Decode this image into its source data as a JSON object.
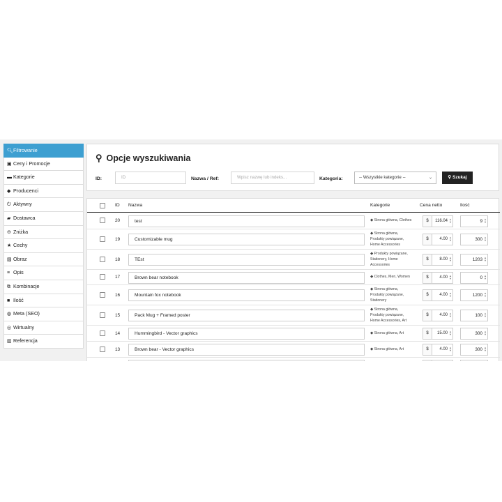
{
  "sidebar": {
    "items": [
      {
        "label": "Filtrowanie",
        "icon": "search-icon",
        "glyph": "🔍︎",
        "active": true
      },
      {
        "label": "Ceny i Promocje",
        "icon": "money-icon",
        "glyph": "▣"
      },
      {
        "label": "Kategorie",
        "icon": "folder-icon",
        "glyph": "▬"
      },
      {
        "label": "Producenci",
        "icon": "tag-icon",
        "glyph": "◆"
      },
      {
        "label": "Aktywny",
        "icon": "power-icon",
        "glyph": "⏻"
      },
      {
        "label": "Dostawca",
        "icon": "truck-icon",
        "glyph": "▰"
      },
      {
        "label": "Zniżka",
        "icon": "minus-circle-icon",
        "glyph": "⊖"
      },
      {
        "label": "Cechy",
        "icon": "star-icon",
        "glyph": "★"
      },
      {
        "label": "Obraz",
        "icon": "image-icon",
        "glyph": "▨"
      },
      {
        "label": "Opis",
        "icon": "align-icon",
        "glyph": "≡"
      },
      {
        "label": "Kombinacje",
        "icon": "copy-icon",
        "glyph": "⧉"
      },
      {
        "label": "Ilość",
        "icon": "box-icon",
        "glyph": "■"
      },
      {
        "label": "Meta (SEO)",
        "icon": "globe-icon",
        "glyph": "◍"
      },
      {
        "label": "Wirtualny",
        "icon": "disc-icon",
        "glyph": "◎"
      },
      {
        "label": "Referencja",
        "icon": "barcode-icon",
        "glyph": "▥"
      }
    ]
  },
  "search": {
    "title": "Opcje wyszukiwania",
    "id_label": "ID:",
    "id_placeholder": "ID",
    "name_label": "Nazwa / Ref:",
    "name_placeholder": "Wpisz nazwę lub indeks...",
    "category_label": "Kategoria:",
    "category_value": "-- Wszystkie kategorie --",
    "search_button": "Szukaj"
  },
  "table": {
    "columns": {
      "id": "ID",
      "name": "Nazwa",
      "category": "Kategorie",
      "price": "Cena netto",
      "qty": "Ilość"
    },
    "currency": "$",
    "rows": [
      {
        "id": "20",
        "name": "test",
        "categories": [
          "Strona główna, Clothes"
        ],
        "price": "116.04",
        "qty": "9"
      },
      {
        "id": "19",
        "name": "Customizable mug",
        "categories": [
          "Strona główna,",
          "Produkty powiązane,",
          "Home Accessories"
        ],
        "price": "4.00",
        "qty": "300"
      },
      {
        "id": "18",
        "name": "TEst",
        "categories": [
          "Produkty powiązane,",
          "Stationery, Home",
          "Accessories"
        ],
        "price": "8.00",
        "qty": "1203"
      },
      {
        "id": "17",
        "name": "Brown bear notebook",
        "categories": [
          "Clothes, Men, Women"
        ],
        "price": "4.00",
        "qty": "0"
      },
      {
        "id": "16",
        "name": "Mountain fox notebook",
        "categories": [
          "Strona główna,",
          "Produkty powiązane,",
          "Stationery"
        ],
        "price": "4.00",
        "qty": "1200"
      },
      {
        "id": "15",
        "name": "Pack Mug + Framed poster",
        "categories": [
          "Strona główna,",
          "Produkty powiązane,",
          "Home Accessories, Art"
        ],
        "price": "4.00",
        "qty": "100"
      },
      {
        "id": "14",
        "name": "Hummingbird - Vector graphics",
        "categories": [
          "Strona główna, Art"
        ],
        "price": "15.00",
        "qty": "300"
      },
      {
        "id": "13",
        "name": "Brown bear - Vector graphics",
        "categories": [
          "Strona główna, Art"
        ],
        "price": "4.00",
        "qty": "300"
      },
      {
        "id": "",
        "name": "",
        "categories": [
          ""
        ],
        "price": "",
        "qty": ""
      }
    ]
  }
}
